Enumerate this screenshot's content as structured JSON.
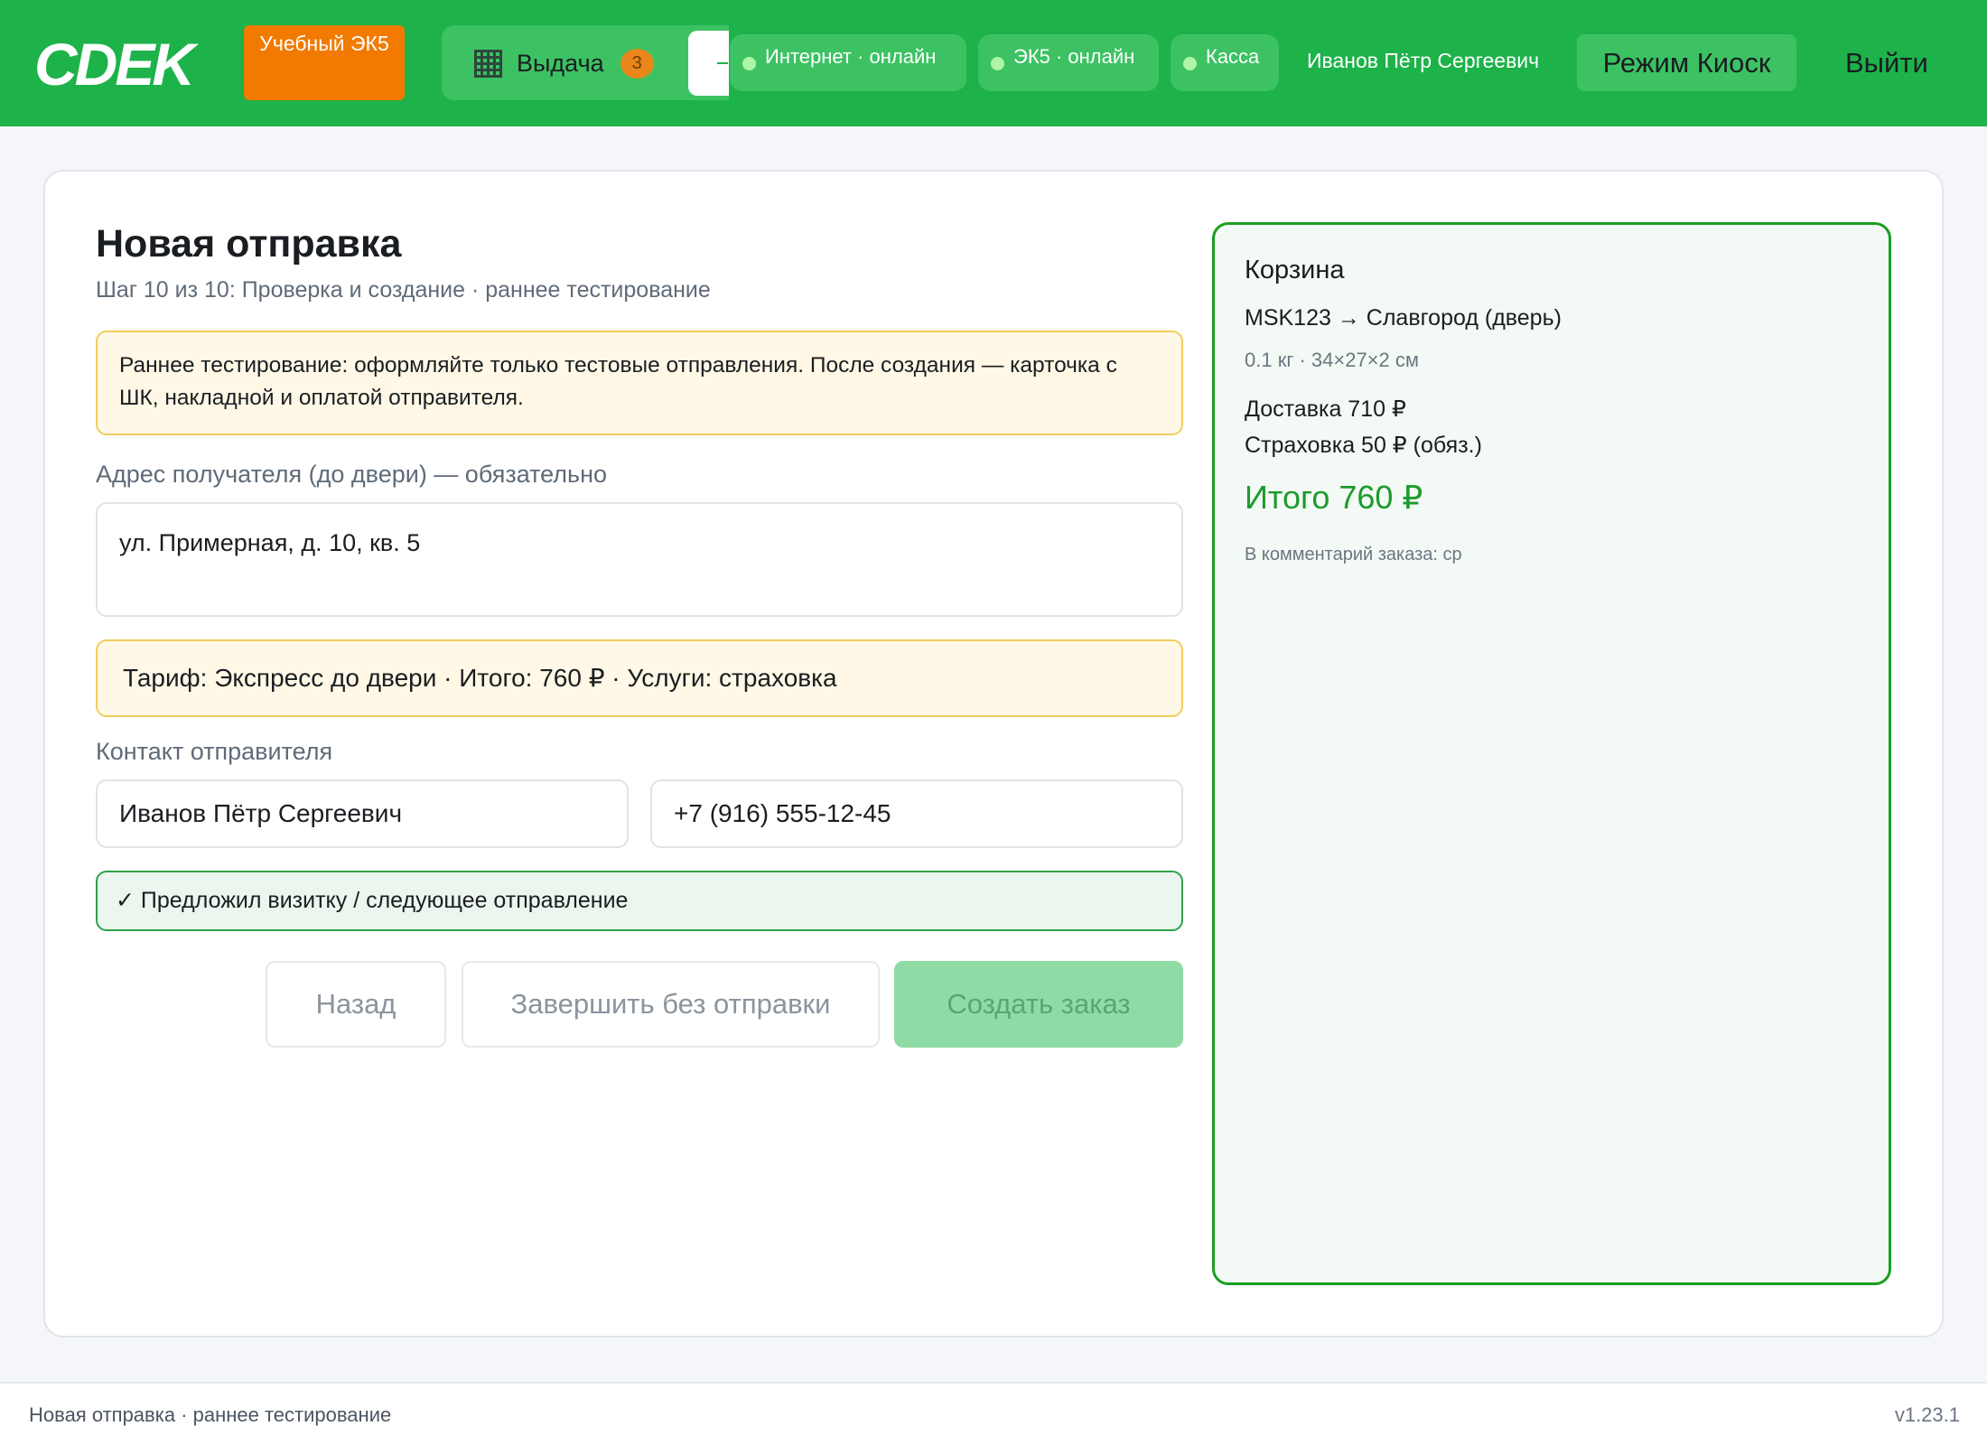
{
  "header": {
    "logo_text": "CDEK",
    "mode_badge": "Учебный ЭК5",
    "nav_tab_label": "Выдача",
    "nav_tab_count": "3",
    "status": {
      "internet": "Интернет · онлайн",
      "ek5": "ЭК5 · онлайн",
      "kassa": "Касса"
    },
    "user_name": "Иванов Пётр Сергеевич",
    "kiosk_label": "Режим Киоск",
    "logout_label": "Выйти"
  },
  "form": {
    "title": "Новая отправка",
    "subtitle": "Шаг 10 из 10: Проверка и создание · раннее тестирование",
    "notice": "Раннее тестирование: оформляйте только тестовые отправления. После создания — карточка с ШК, накладной и оплатой отправителя.",
    "address_label": "Адрес получателя (до двери) — обязательно",
    "address_value": "ул. Примерная, д. 10, кв. 5",
    "tariff_text": "Тариф: Экспресс до двери · Итого: 760 ₽ · Услуги: страховка",
    "contact_label": "Контакт отправителя",
    "contact_name": "Иванов Пётр Сергеевич",
    "contact_phone": "+7 (916) 555-12-45",
    "check_text": "✓ Предложил визитку / следующее отправление",
    "buttons": {
      "back": "Назад",
      "finish": "Завершить без отправки",
      "create": "Создать заказ"
    }
  },
  "cart": {
    "title": "Корзина",
    "route": "MSK123 → Славгород (дверь)",
    "params": "0.1 кг · 34×27×2 см",
    "delivery": "Доставка 710 ₽",
    "insurance": "Страховка 50 ₽ (обяз.)",
    "total": "Итого 760 ₽",
    "comment": "В комментарий заказа: ср"
  },
  "footer": {
    "left": "Новая отправка · раннее тестирование",
    "version": "v1.23.1"
  },
  "colors": {
    "brand": "#1db24a",
    "mode_badge": "#f27a00",
    "total": "#1d9a2e",
    "warning_bg": "#fff8e6",
    "warning_border": "#f2cc5a"
  }
}
